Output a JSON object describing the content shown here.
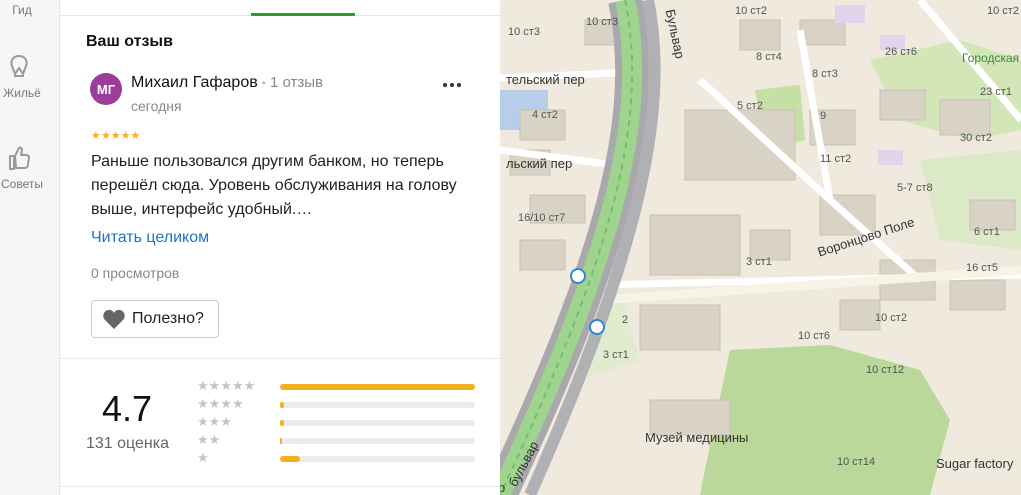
{
  "rail": {
    "items": [
      {
        "label": "Гид"
      },
      {
        "label": "Жильё"
      },
      {
        "label": "Советы"
      }
    ]
  },
  "review": {
    "section_title": "Ваш отзыв",
    "avatar_initials": "МГ",
    "author": "Михаил Гафаров",
    "author_reviews": "1 отзыв",
    "date": "сегодня",
    "stars": "★★★★★",
    "text": "Раньше пользовался другим банком, но теперь перешёл сюда. Уровень обслуживания на голову выше, интерфейс удобный.…",
    "read_more": "Читать целиком",
    "views": "0 просмотров",
    "useful_label": "Полезно?"
  },
  "rating": {
    "value": "4.7",
    "count_label": "131 оценка",
    "distribution": [
      {
        "stars": "★★★★★",
        "fraction": 1.0
      },
      {
        "stars": "★★★★",
        "fraction": 0.02
      },
      {
        "stars": "★★★",
        "fraction": 0.02
      },
      {
        "stars": "★★",
        "fraction": 0.01
      },
      {
        "stars": "★",
        "fraction": 0.1
      }
    ],
    "accent": "#f3b11d"
  },
  "map": {
    "labels": [
      "10 ст3",
      "10 ст2",
      "26 ст6",
      "Городская",
      "тельский пер",
      "8 ст4",
      "8 ст3",
      "23 ст1",
      "4 ст2",
      "5 ст2",
      "9",
      "30 ст2",
      "льский пер",
      "11 ст2",
      "5-7 ст8",
      "16/10 ст7",
      "6 ст1",
      "3 ст1",
      "Воронцово Поле",
      "16 ст5",
      "2",
      "10 ст2",
      "10 ст6",
      "3 ст1",
      "10 ст12",
      "Музей медицины",
      "10 ст14",
      "Sugar factory",
      "Бульвар",
      "бульвар",
      "р",
      "10 ст2",
      "10 ст3"
    ]
  }
}
